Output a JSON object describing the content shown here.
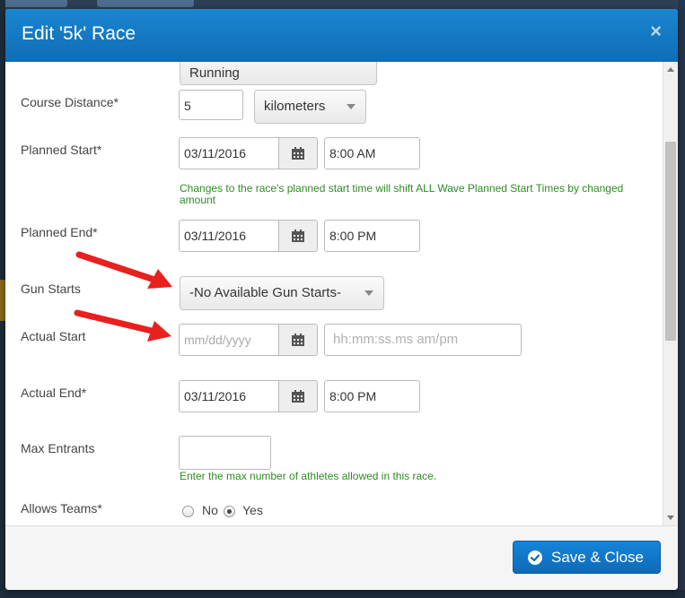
{
  "dialog": {
    "title": "Edit '5k' Race",
    "close_icon": "×"
  },
  "form": {
    "race_type_value": "Running",
    "course_distance": {
      "label": "Course Distance*",
      "value": "5",
      "unit": "kilometers"
    },
    "planned_start": {
      "label": "Planned Start*",
      "date": "03/11/2016",
      "time": "8:00 AM",
      "help": "Changes to the race's planned start time will shift ALL Wave Planned Start Times by changed amount"
    },
    "planned_end": {
      "label": "Planned End*",
      "date": "03/11/2016",
      "time": "8:00 PM"
    },
    "gun_starts": {
      "label": "Gun Starts",
      "selected": "-No Available Gun Starts-"
    },
    "actual_start": {
      "label": "Actual Start",
      "date_placeholder": "mm/dd/yyyy",
      "time_placeholder": "hh:mm:ss.ms am/pm"
    },
    "actual_end": {
      "label": "Actual End*",
      "date": "03/11/2016",
      "time": "8:00 PM"
    },
    "max_entrants": {
      "label": "Max Entrants",
      "value": "",
      "help": "Enter the max number of athletes allowed in this race."
    },
    "allows_teams": {
      "label": "Allows Teams*",
      "options": [
        "No",
        "Yes"
      ],
      "selected": "Yes"
    }
  },
  "footer": {
    "save_label": "Save & Close"
  },
  "colors": {
    "header_blue": "#1a86d0",
    "help_green": "#2e8b22",
    "arrow_red": "#e8201e",
    "button_blue": "#1684d8"
  },
  "icons": [
    "calendar-icon",
    "check-circle-icon",
    "close-icon",
    "chevron-down-icon"
  ]
}
